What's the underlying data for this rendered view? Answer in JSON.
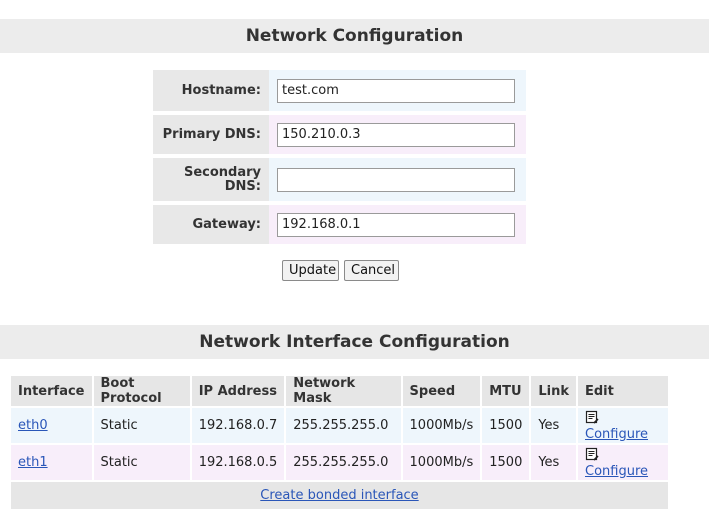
{
  "network_config": {
    "title": "Network Configuration",
    "fields": [
      {
        "label": "Hostname:",
        "value": "test.com"
      },
      {
        "label": "Primary DNS:",
        "value": "150.210.0.3"
      },
      {
        "label": "Secondary DNS:",
        "value": ""
      },
      {
        "label": "Gateway:",
        "value": "192.168.0.1"
      }
    ],
    "update_label": "Update",
    "cancel_label": "Cancel"
  },
  "interfaces": {
    "title": "Network Interface Configuration",
    "columns": [
      "Interface",
      "Boot Protocol",
      "IP Address",
      "Network Mask",
      "Speed",
      "MTU",
      "Link",
      "Edit"
    ],
    "rows": [
      {
        "interface": "eth0",
        "boot": "Static",
        "ip": "192.168.0.7",
        "mask": "255.255.255.0",
        "speed": "1000Mb/s",
        "mtu": "1500",
        "link": "Yes",
        "edit": "Configure"
      },
      {
        "interface": "eth1",
        "boot": "Static",
        "ip": "192.168.0.5",
        "mask": "255.255.255.0",
        "speed": "1000Mb/s",
        "mtu": "1500",
        "link": "Yes",
        "edit": "Configure"
      }
    ],
    "create_bonded": "Create bonded interface",
    "edit_icon": "edit-script-icon"
  },
  "colors": {
    "header_bg": "#ececec",
    "link": "#2a56b8",
    "row_blue": "#eef6fc",
    "row_pink": "#f8eefa"
  }
}
